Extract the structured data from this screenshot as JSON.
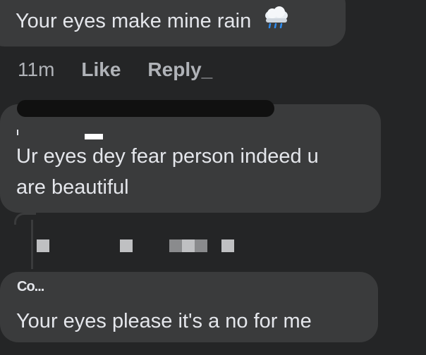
{
  "comments": [
    {
      "text": "Your eyes make mine rain",
      "icon": "cloud-rain-icon",
      "time": "11m",
      "like": "Like",
      "reply": "Reply_"
    },
    {
      "text_line1": "Ur eyes dey fear person indeed u",
      "text_line2": "are beautiful"
    },
    {
      "author_partial": "Co...",
      "text": "Your eyes please it's a no for me"
    }
  ]
}
